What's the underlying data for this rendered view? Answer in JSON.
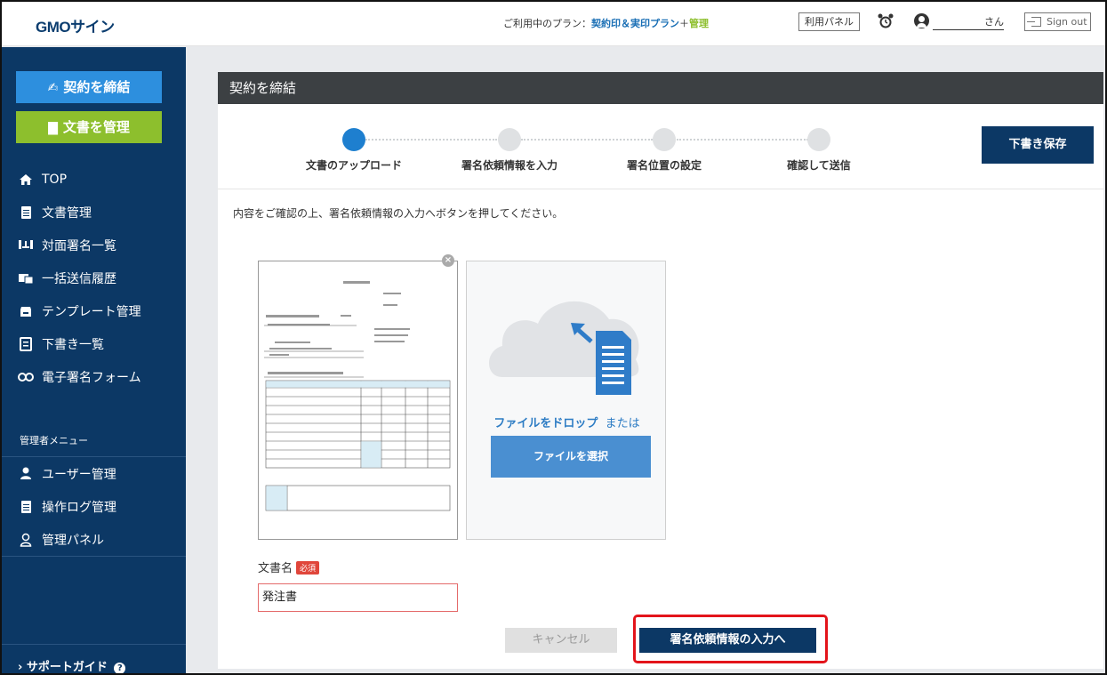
{
  "header": {
    "logo": "GMOサイン",
    "plan_prefix": "ご利用中のプラン：",
    "plan_name": "契約印＆実印プラン",
    "plan_plus": "＋",
    "plan_addon": "管理",
    "panel_button": "利用パネル",
    "user_suffix": "さん",
    "signout": "Sign out"
  },
  "sidebar": {
    "primary_button": "契約を締結",
    "secondary_button": "文書を管理",
    "nav": [
      {
        "label": "TOP",
        "icon": "home-icon"
      },
      {
        "label": "文書管理",
        "icon": "document-icon"
      },
      {
        "label": "対面署名一覧",
        "icon": "face-to-face-icon"
      },
      {
        "label": "一括送信履歴",
        "icon": "bulk-send-icon"
      },
      {
        "label": "テンプレート管理",
        "icon": "template-icon"
      },
      {
        "label": "下書き一覧",
        "icon": "draft-icon"
      },
      {
        "label": "電子署名フォーム",
        "icon": "link-icon"
      }
    ],
    "admin_title": "管理者メニュー",
    "admin_nav": [
      {
        "label": "ユーザー管理",
        "icon": "user-icon"
      },
      {
        "label": "操作ログ管理",
        "icon": "log-icon"
      },
      {
        "label": "管理パネル",
        "icon": "admin-panel-icon"
      }
    ],
    "support": "サポートガイド"
  },
  "main": {
    "title": "契約を締結",
    "steps": [
      {
        "label": "文書のアップロード",
        "active": true
      },
      {
        "label": "署名依頼情報を入力",
        "active": false
      },
      {
        "label": "署名位置の設定",
        "active": false
      },
      {
        "label": "確認して送信",
        "active": false
      }
    ],
    "draft_button": "下書き保存",
    "instruction": "内容をご確認の上、署名依頼情報の入力へボタンを押してください。",
    "drop_text": "ファイルをドロップ",
    "drop_or": "または",
    "select_button": "ファイルを選択",
    "docname_label": "文書名",
    "required_badge": "必須",
    "docname_value": "発注書",
    "cancel_button": "キャンセル",
    "next_button": "署名依頼情報の入力へ"
  },
  "colors": {
    "sidebar": "#0c3865",
    "accent_blue": "#2d8fde",
    "accent_green": "#8dbf2d",
    "highlight": "#e3141b"
  }
}
